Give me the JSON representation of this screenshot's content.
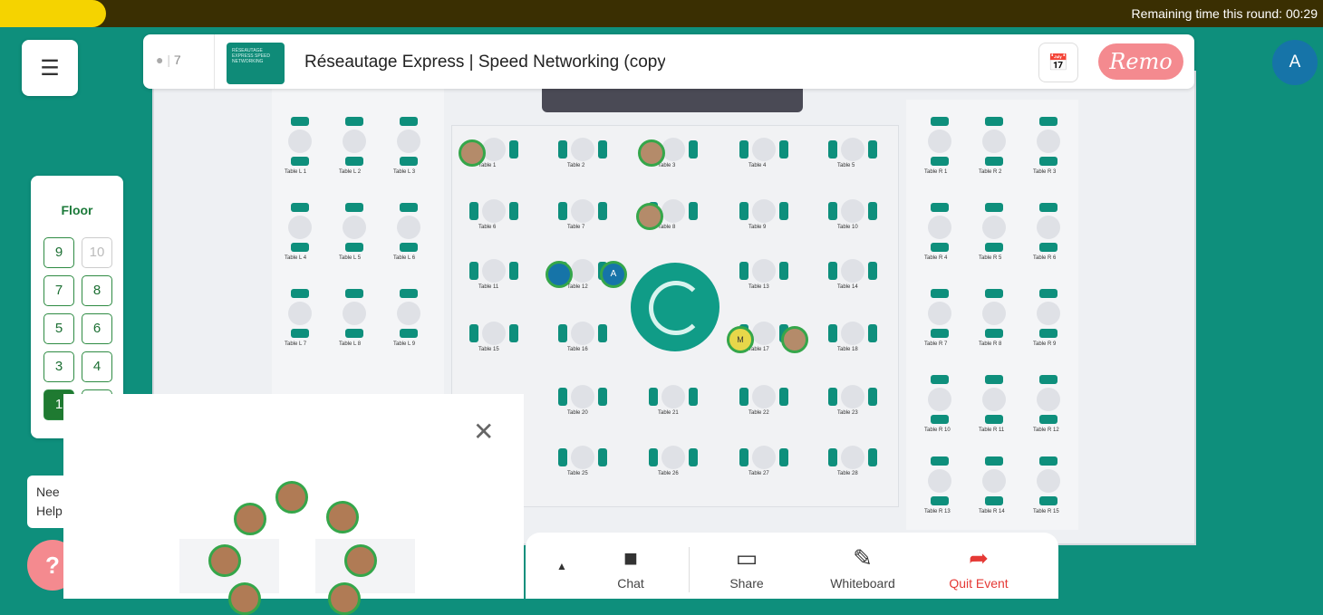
{
  "round_timer": {
    "label": "Remaining time this round: 00:29",
    "progress_fraction": 0.08
  },
  "event": {
    "participant_count": "7",
    "title": "Réseautage Express | Speed Networking (copy",
    "thumbnail_text": "RÉSEAUTAGE EXPRESS SPEED NETWORKING",
    "brand": "Remo",
    "user_initial": "A"
  },
  "floor_panel": {
    "title": "Floor",
    "floors": [
      {
        "label": "9",
        "state": "normal"
      },
      {
        "label": "10",
        "state": "disabled"
      },
      {
        "label": "7",
        "state": "normal"
      },
      {
        "label": "8",
        "state": "normal"
      },
      {
        "label": "5",
        "state": "normal"
      },
      {
        "label": "6",
        "state": "normal"
      },
      {
        "label": "3",
        "state": "normal"
      },
      {
        "label": "4",
        "state": "normal"
      },
      {
        "label": "1",
        "state": "active"
      },
      {
        "label": "",
        "state": "normal"
      }
    ]
  },
  "help": {
    "tip_line1": "Nee",
    "tip_line2": "Help",
    "icon": "question-icon"
  },
  "bottom_bar": {
    "chat": "Chat",
    "share": "Share",
    "whiteboard": "Whiteboard",
    "quit": "Quit Event"
  },
  "tables": {
    "left": [
      "Table L 1",
      "Table L 2",
      "Table L 3",
      "Table L 4",
      "Table L 5",
      "Table L 6",
      "Table L 7",
      "Table L 8",
      "Table L 9"
    ],
    "center": [
      "Table 1",
      "Table 2",
      "Table 3",
      "Table 4",
      "Table 5",
      "Table 6",
      "Table 7",
      "Table 8",
      "Table 9",
      "Table 10",
      "Table 11",
      "Table 12",
      "Table 13",
      "Table 14",
      "Table 15",
      "Table 16",
      "Table 17",
      "Table 18",
      "Table 20",
      "Table 21",
      "Table 22",
      "Table 23",
      "Table 25",
      "Table 26",
      "Table 27",
      "Table 28"
    ],
    "right": [
      "Table R 1",
      "Table R 2",
      "Table R 3",
      "Table R 4",
      "Table R 5",
      "Table R 6",
      "Table R 7",
      "Table R 8",
      "Table R 9",
      "Table R 10",
      "Table R 11",
      "Table R 12",
      "Table R 13",
      "Table R 14",
      "Table R 15"
    ]
  },
  "participants_on_map": [
    "A",
    "M"
  ],
  "colors": {
    "accent": "#0e8f7c",
    "brand": "#f48a8f",
    "timer_bar": "#f5d300",
    "floor_active": "#1f7a31",
    "quit": "#e53935"
  }
}
